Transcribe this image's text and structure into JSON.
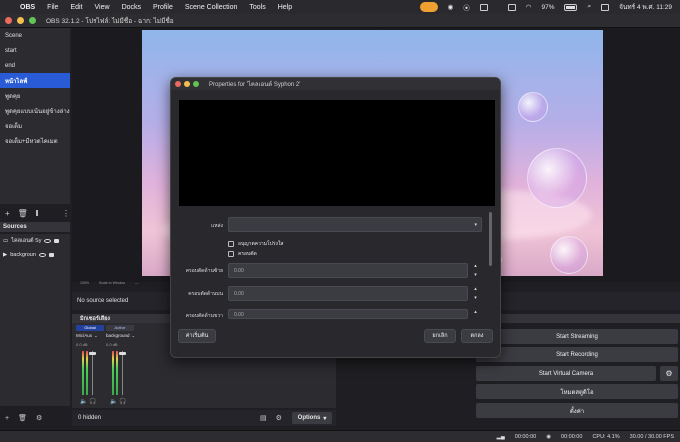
{
  "menubar": {
    "app_name": "OBS",
    "items": [
      "File",
      "Edit",
      "View",
      "Docks",
      "Profile",
      "Scene Collection",
      "Tools",
      "Help"
    ],
    "battery": "97%",
    "datetime": "จันทร์ 4 พ.ศ.  11:29"
  },
  "window": {
    "title": "OBS 32.1.2 - โปรไฟล์: ไม่มีชื่อ - ฉาก: ไม่มีชื่อ"
  },
  "scenes": {
    "items": [
      "Scene",
      "start",
      "end",
      "หน้าไลฟ์",
      "พูดคุย",
      "พูดคุยแบบเน้นอยู่ข้างล่าง",
      "จอเต็ม",
      "จอเต็ม+มีหวดไคเมต"
    ],
    "active_index": 3
  },
  "sources": {
    "header": "Sources",
    "items": [
      "ไคลเอนต์ Sy",
      "backgroun"
    ],
    "no_source": "No source selected"
  },
  "preview": {
    "zoom_strip": [
      "100%",
      "Scale to Window",
      "—"
    ]
  },
  "mixer": {
    "header": "มิกเซอร์เสียง",
    "channels": [
      {
        "tag": "Global",
        "name": "Mic/Aux",
        "db": "0.0 dB"
      },
      {
        "tag": "Active",
        "name": "background",
        "db": "0.0 dB"
      }
    ]
  },
  "controls": {
    "start_streaming": "Start Streaming",
    "start_recording": "Start Recording",
    "start_virtual_camera": "Start Virtual Camera",
    "studio_mode": "โหมดสตูดิโอ",
    "settings": "ตั้งค่า"
  },
  "bottom": {
    "hidden_count": "0 hidden",
    "options": "Options"
  },
  "status": {
    "time1": "00:00:00",
    "time2": "00:00:00",
    "cpu": "CPU: 4.1%",
    "fps": "30.00 / 30.00 FPS"
  },
  "dialog": {
    "title": "Properties for 'ไคลเอนต์ Syphon 2'",
    "source_label": "แหล่ง",
    "allow_transparency": "อนุญาตความโปร่งใส",
    "crop": "ครอบตัด",
    "crop_left_label": "ครอบตัดด้านซ้าย",
    "crop_top_label": "ครอบตัดด้านบน",
    "crop_right_label": "ครอบตัดด้านขวา",
    "crop_left_value": "0.00",
    "crop_top_value": "0.00",
    "crop_right_value": "0.00",
    "defaults_button": "ค่าเริ่มต้น",
    "cancel_button": "ยกเลิก",
    "ok_button": "ตกลง"
  }
}
